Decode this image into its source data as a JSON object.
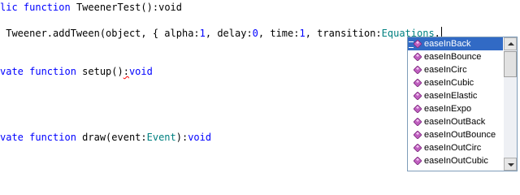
{
  "code": {
    "line1": {
      "keyword": "lic function",
      "name": "TweenerTest",
      "tail": "():void"
    },
    "line2": {
      "text": " Tweener.addTween(object, { alpha:",
      "v1": "1",
      "sep1": ", delay:",
      "v2": "0",
      "sep2": ", time:",
      "v3": "1",
      "sep3": ", transition:",
      "cls": "Equations",
      "dot": "."
    },
    "line3": {
      "keyword": "vate function",
      "name": " setup()",
      "squiggle": ":",
      "type": "void"
    },
    "line4": {
      "keyword": "vate function",
      "name": " draw(event:",
      "type1": "Event",
      "mid": "):",
      "type2": "void"
    }
  },
  "autocomplete": {
    "selected_index": 0,
    "items": [
      "easeInBack",
      "easeInBounce",
      "easeInCirc",
      "easeInCubic",
      "easeInElastic",
      "easeInExpo",
      "easeInOutBack",
      "easeInOutBounce",
      "easeInOutCirc",
      "easeInOutCubic"
    ]
  },
  "icons": {
    "item_icon": "method-diamond-icon",
    "icon_color": "#c060c0"
  }
}
